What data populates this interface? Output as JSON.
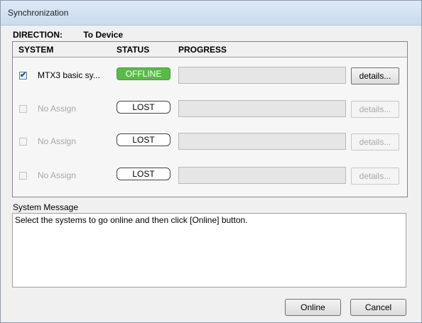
{
  "window": {
    "title": "Synchronization"
  },
  "direction": {
    "label": "DIRECTION:",
    "value": "To Device"
  },
  "columns": {
    "system": "SYSTEM",
    "status": "STATUS",
    "progress": "PROGRESS"
  },
  "rows": [
    {
      "checked": true,
      "enabled": true,
      "system": "MTX3 basic sy...",
      "status": "OFFLINE",
      "status_color": "#5bb94a",
      "progress_fraction": 0,
      "details": "details..."
    },
    {
      "checked": false,
      "enabled": false,
      "system": "No Assign",
      "status": "LOST",
      "progress_fraction": 0,
      "details": "details..."
    },
    {
      "checked": false,
      "enabled": false,
      "system": "No Assign",
      "status": "LOST",
      "progress_fraction": 0,
      "details": "details..."
    },
    {
      "checked": false,
      "enabled": false,
      "system": "No Assign",
      "status": "LOST",
      "progress_fraction": 0,
      "details": "details..."
    }
  ],
  "system_message": {
    "label": "System Message",
    "text": "Select the systems to go online and then click [Online] button."
  },
  "buttons": {
    "online": "Online",
    "cancel": "Cancel"
  }
}
